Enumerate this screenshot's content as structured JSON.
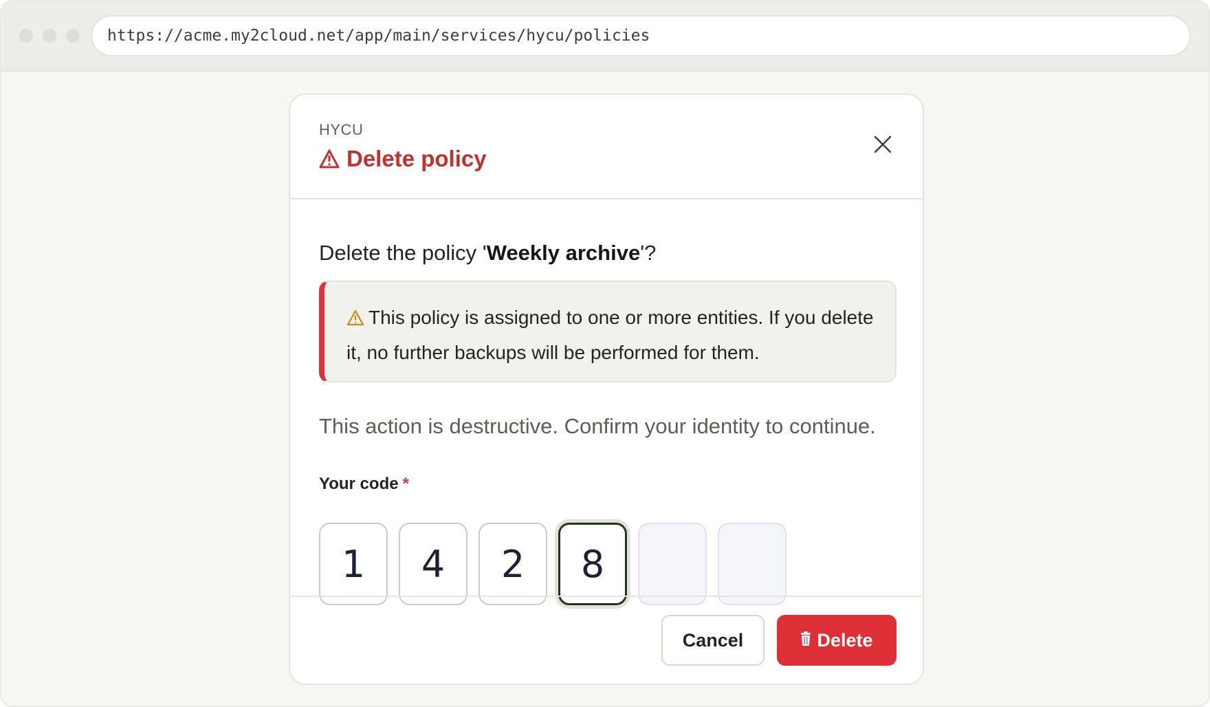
{
  "browser": {
    "url": "https://acme.my2cloud.net/app/main/services/hycu/policies"
  },
  "dialog": {
    "eyebrow": "HYCU",
    "title": "Delete policy",
    "close_icon": "close-icon",
    "question_prefix": "Delete the policy '",
    "policy_name": "Weekly archive",
    "question_suffix": "'?",
    "warning_text": "This policy is assigned to one or more entities. If you delete it, no further backups will be performed for them.",
    "destructive_note": "This action is destructive. Confirm your identity to continue.",
    "code_label": "Your code",
    "required_mark": "*",
    "code_digits": [
      "1",
      "4",
      "2",
      "8",
      "",
      ""
    ],
    "cancel_label": "Cancel",
    "delete_label": "Delete"
  },
  "colors": {
    "danger": "#dc2f36",
    "title_red": "#c0312f",
    "warning_amber": "#c98a16",
    "page_bg": "#f6f7f1"
  }
}
